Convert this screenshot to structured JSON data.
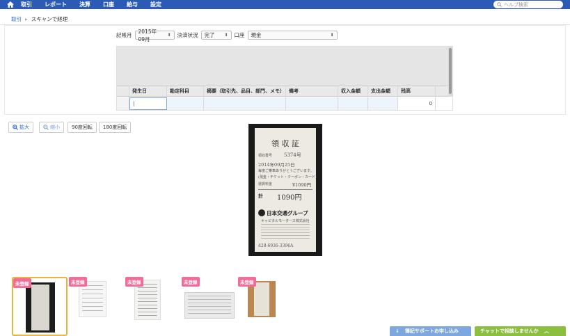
{
  "nav": {
    "items": [
      "取引",
      "レポート",
      "決算",
      "口座",
      "給与",
      "設定"
    ],
    "search_placeholder": "ヘルプ検索"
  },
  "breadcrumb": {
    "link": "取引",
    "separator": "▸",
    "current": "スキャンで経理"
  },
  "filters": {
    "month_label": "記帳月",
    "month_value": "2015年09月",
    "status_label": "決済状況",
    "status_value": "完了",
    "account_label": "口座",
    "account_value": "現金"
  },
  "grid": {
    "columns": [
      "発生日",
      "勘定科目",
      "摘要（取引先、品目、部門、メモ）",
      "備考",
      "収入金額",
      "支出金額",
      "残高"
    ],
    "row": {
      "date": "|",
      "balance": "0"
    }
  },
  "tools": {
    "zoom_in": "拡大",
    "zoom_out": "縮小",
    "rotate_90": "90度回転",
    "rotate_180": "180度回転"
  },
  "receipt": {
    "title": "領 収 証",
    "number_label": "領収書号",
    "number": "5374号",
    "date": "2014年09月25日",
    "thanks": "毎度ご乗車ありがとうございます。",
    "method": "(現金・チケット・クーポン・カード)",
    "fare_label": "運賃料金",
    "fare": "¥1090円",
    "total_label": "計",
    "total": "1090円",
    "company": "日本交通グループ",
    "company_sub": "キャピタルモータース株式会社",
    "phone": "428-6936-3396A"
  },
  "thumbnails": {
    "badge": "未登録"
  },
  "footer": {
    "support": "簿記サポートお申し込み",
    "chat": "チャットで相談しませんか"
  },
  "colors": {
    "nav_bg": "#2c5bb5",
    "badge": "#f06c9b",
    "chat": "#8cbf3f",
    "support": "#7ea7e0",
    "selected_border": "#f0b23a"
  }
}
